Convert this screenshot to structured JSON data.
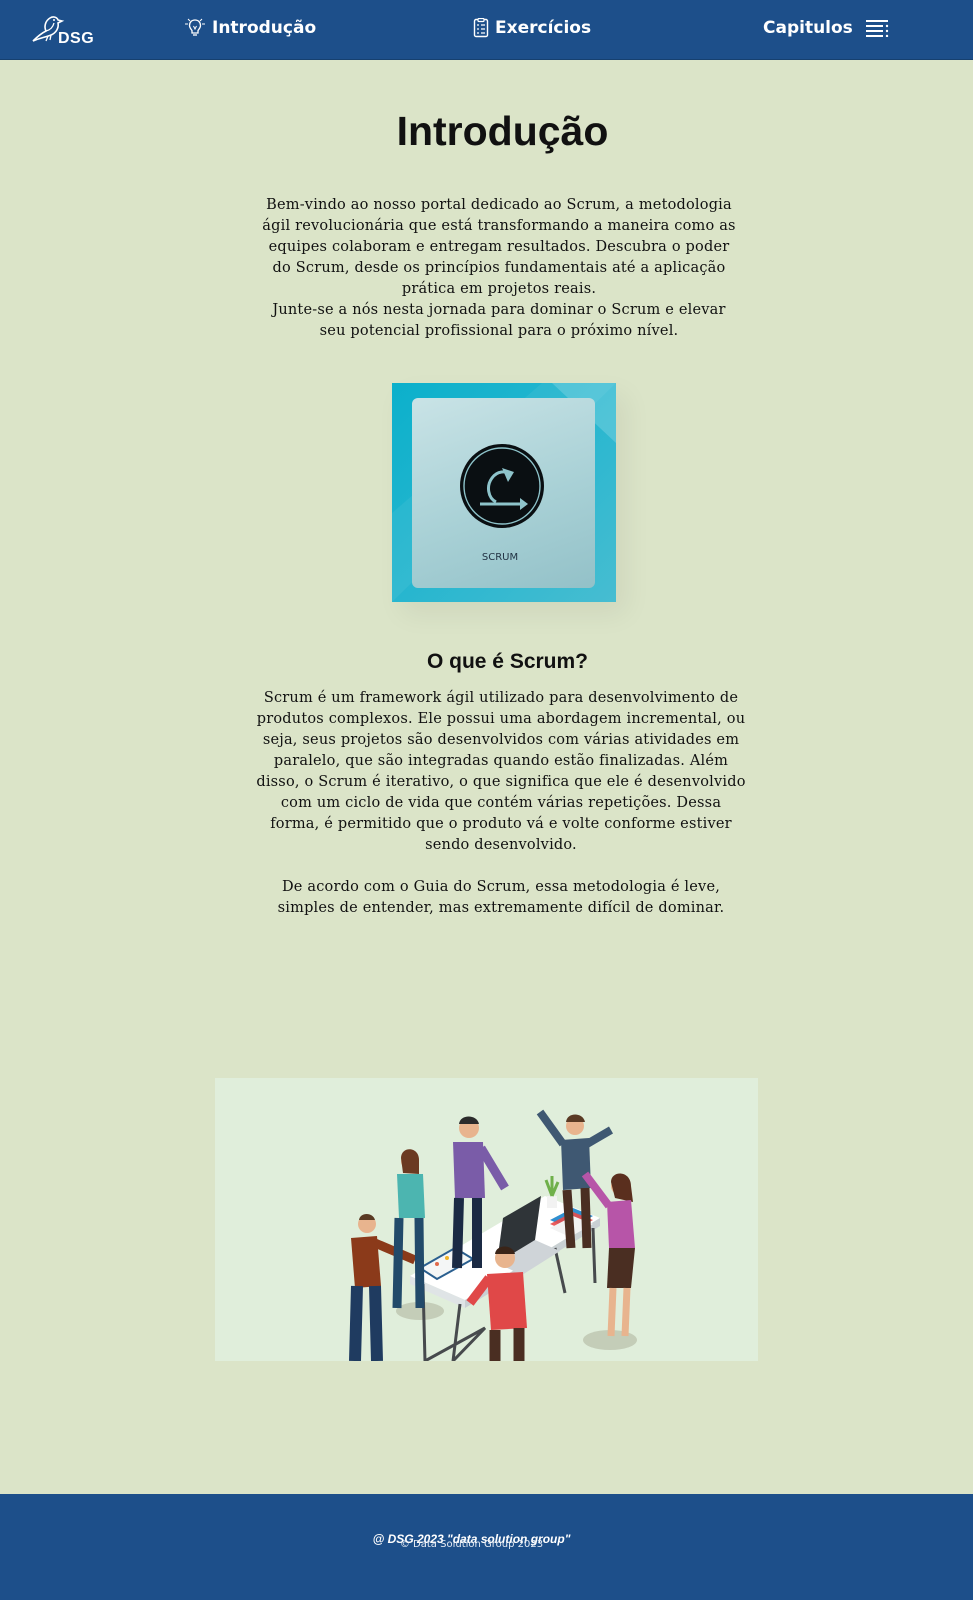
{
  "nav": {
    "logo_text": "DSG",
    "items": [
      {
        "label": "Introdução",
        "icon": "lightbulb-icon"
      },
      {
        "label": "Exercícios",
        "icon": "clipboard-list-icon"
      },
      {
        "label": "Capitulos",
        "icon": "list-menu-icon"
      }
    ]
  },
  "main": {
    "title": "Introdução",
    "intro_paragraph_1": "Bem-vindo ao nosso portal dedicado ao Scrum, a metodologia ágil revolucionária que está transformando a maneira como as equipes colaboram e entregam resultados. Descubra o poder do Scrum, desde os princípios fundamentais até a aplicação prática em projetos reais.",
    "intro_paragraph_2": "Junte-se a nós nesta jornada para dominar o Scrum e elevar seu potencial profissional para o próximo nível.",
    "scrum_image_label": "SCRUM",
    "section_title": "O que é Scrum?",
    "section_paragraph_1": "Scrum é um framework ágil utilizado para desenvolvimento de produtos complexos. Ele possui uma abordagem incremental, ou seja, seus projetos são desenvolvidos com várias atividades em paralelo, que são integradas quando estão finalizadas. Além disso, o Scrum é iterativo, o que significa que ele é desenvolvido com um ciclo de vida que contém várias repetições. Dessa forma, é permitido que o produto vá e volte conforme estiver sendo desenvolvido.",
    "section_paragraph_2": "De acordo com o Guia do Scrum, essa metodologia é leve, simples de entender, mas extremamente difícil de dominar."
  },
  "footer": {
    "main_text": "@ DSG 2023 \"data solution group\"",
    "sub_text": "© Data Solution Group 2023"
  },
  "colors": {
    "navbar": "#1d4f8a",
    "page_background": "#dbe4c8",
    "scrum_image": "#0bb0cb",
    "team_image_background": "#e0eedb"
  }
}
